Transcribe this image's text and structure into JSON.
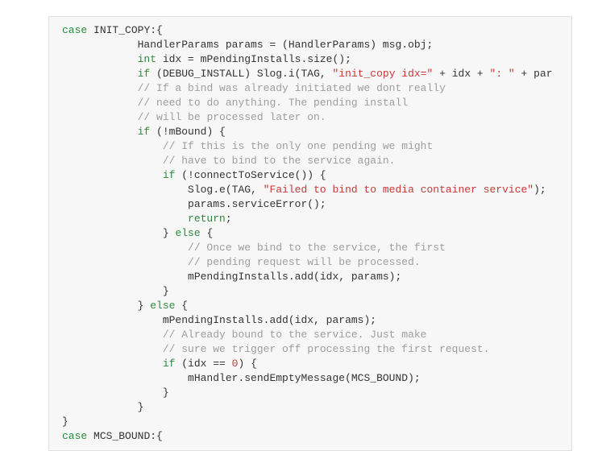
{
  "code": {
    "l1_case": "case",
    "l1_id": "INIT_COPY",
    "l1_end": ":{",
    "l2a": "HandlerParams params = (HandlerParams) msg.obj;",
    "l3_kw": "int",
    "l3_rest": " idx = mPendingInstalls.size();",
    "l4_kw": "if",
    "l4_a": " (DEBUG_INSTALL) Slog.i(TAG, ",
    "l4_s1": "\"init_copy idx=\"",
    "l4_b": " + idx + ",
    "l4_s2": "\": \"",
    "l4_c": " + par",
    "l5": "// If a bind was already initiated we dont really",
    "l6": "// need to do anything. The pending install",
    "l7": "// will be processed later on.",
    "l8_kw": "if",
    "l8_rest": " (!mBound) {",
    "l9": "// If this is the only one pending we might",
    "l10": "// have to bind to the service again.",
    "l11_kw": "if",
    "l11_rest": " (!connectToService()) {",
    "l12_a": "Slog.e(TAG, ",
    "l12_s": "\"Failed to bind to media container service\"",
    "l12_b": ");",
    "l13": "params.serviceError();",
    "l14_kw": "return",
    "l14_rest": ";",
    "l15_a": "} ",
    "l15_kw": "else",
    "l15_b": " {",
    "l16": "// Once we bind to the service, the first",
    "l17": "// pending request will be processed.",
    "l18": "mPendingInstalls.add(idx, params);",
    "l19": "}",
    "l20_a": "} ",
    "l20_kw": "else",
    "l20_b": " {",
    "l21": "mPendingInstalls.add(idx, params);",
    "l22": "// Already bound to the service. Just make",
    "l23": "// sure we trigger off processing the first request.",
    "l24_kw": "if",
    "l24_a": " (idx == ",
    "l24_num": "0",
    "l24_b": ") {",
    "l25": "mHandler.sendEmptyMessage(MCS_BOUND);",
    "l26": "}",
    "l27": "}",
    "l28": "}",
    "l29_case": "case",
    "l29_id": "MCS_BOUND",
    "l29_end": ":{"
  }
}
